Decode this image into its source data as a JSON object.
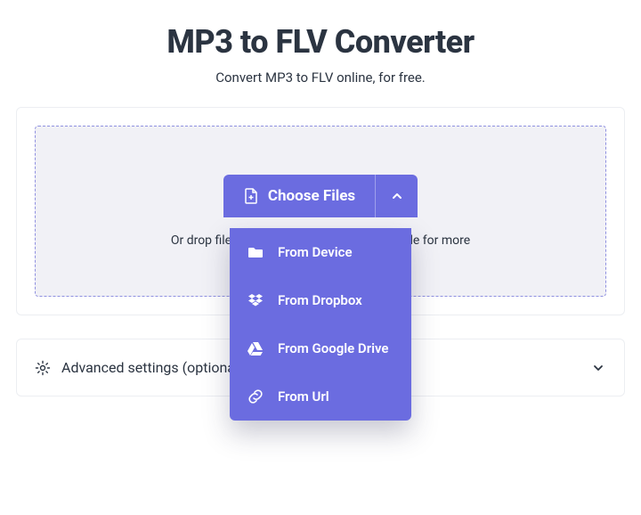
{
  "header": {
    "title": "MP3 to FLV Converter",
    "subtitle": "Convert MP3 to FLV online, for free."
  },
  "upload": {
    "choose_label": "Choose Files",
    "drop_hint": "Or drop files here. Max file size 1GB. Upgrade for more",
    "menu": {
      "items": [
        {
          "icon": "folder-icon",
          "label": "From Device"
        },
        {
          "icon": "dropbox-icon",
          "label": "From Dropbox"
        },
        {
          "icon": "google-drive-icon",
          "label": "From Google Drive"
        },
        {
          "icon": "link-icon",
          "label": "From Url"
        }
      ]
    }
  },
  "advanced": {
    "label": "Advanced settings (optional)"
  },
  "colors": {
    "accent": "#6b6ce0",
    "dropzone_bg": "#f1f1f6",
    "text": "#2b3441"
  }
}
